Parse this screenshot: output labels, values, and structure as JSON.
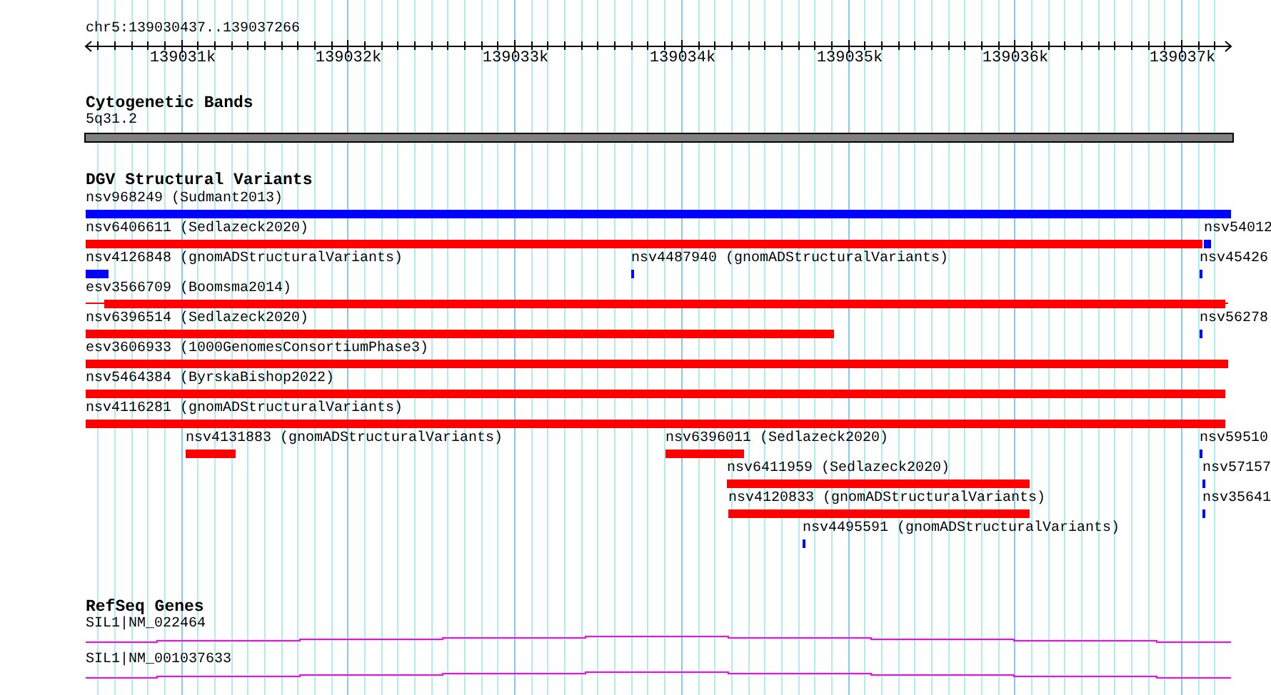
{
  "ruler": {
    "location": "chr5:139030437..139037266",
    "tick_labels": [
      "139031k",
      "139032k",
      "139033k",
      "139034k",
      "139035k",
      "139036k",
      "139037k"
    ]
  },
  "cytogenetic_bands": {
    "title": "Cytogenetic Bands",
    "band": {
      "label": "5q31.2"
    }
  },
  "dgv_structural_variants": {
    "title": "DGV Structural Variants",
    "rows": [
      {
        "features": [
          {
            "label": "nsv968249 (Sudmant2013)",
            "color": "#0000ff"
          }
        ]
      },
      {
        "features": [
          {
            "label": "nsv6406611 (Sedlazeck2020)",
            "color": "#ff0000"
          },
          {
            "label": "nsv54012",
            "color": "#0000ff"
          }
        ]
      },
      {
        "features": [
          {
            "label": "nsv4126848 (gnomADStructuralVariants)",
            "color": "#0000ff"
          },
          {
            "label": "nsv4487940 (gnomADStructuralVariants)",
            "color": "#0000ff"
          },
          {
            "label": "nsv45426",
            "color": "#0000ff"
          }
        ]
      },
      {
        "features": [
          {
            "label": "esv3566709 (Boomsma2014)",
            "color": "#ff0000"
          }
        ]
      },
      {
        "features": [
          {
            "label": "nsv6396514 (Sedlazeck2020)",
            "color": "#ff0000"
          },
          {
            "label": "nsv56278",
            "color": "#0000ff"
          }
        ]
      },
      {
        "features": [
          {
            "label": "esv3606933 (1000GenomesConsortiumPhase3)",
            "color": "#ff0000"
          }
        ]
      },
      {
        "features": [
          {
            "label": "nsv5464384 (ByrskaBishop2022)",
            "color": "#ff0000"
          }
        ]
      },
      {
        "features": [
          {
            "label": "nsv4116281 (gnomADStructuralVariants)",
            "color": "#ff0000"
          }
        ]
      },
      {
        "features": [
          {
            "label": "nsv4131883 (gnomADStructuralVariants)",
            "color": "#ff0000"
          },
          {
            "label": "nsv6396011 (Sedlazeck2020)",
            "color": "#ff0000"
          },
          {
            "label": "nsv59510",
            "color": "#0000ff"
          }
        ]
      },
      {
        "features": [
          {
            "label": "nsv6411959 (Sedlazeck2020)",
            "color": "#ff0000"
          },
          {
            "label": "nsv57157",
            "color": "#0000ff"
          }
        ]
      },
      {
        "features": [
          {
            "label": "nsv4120833 (gnomADStructuralVariants)",
            "color": "#ff0000"
          },
          {
            "label": "nsv35641",
            "color": "#0000ff"
          }
        ]
      },
      {
        "features": [
          {
            "label": "nsv4495591 (gnomADStructuralVariants)",
            "color": "#0000ff"
          }
        ]
      }
    ]
  },
  "refseq_genes": {
    "title": "RefSeq Genes",
    "transcripts": [
      {
        "label": "SIL1|NM_022464"
      },
      {
        "label": "SIL1|NM_001037633"
      }
    ]
  }
}
